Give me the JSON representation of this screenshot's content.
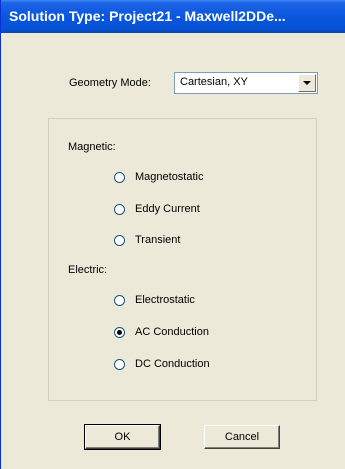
{
  "window": {
    "title": "Solution Type: Project21 - Maxwell2DDe..."
  },
  "geometry": {
    "label": "Geometry Mode:",
    "selected": "Cartesian, XY"
  },
  "magnetic": {
    "label": "Magnetic:",
    "options": [
      "Magnetostatic",
      "Eddy Current",
      "Transient"
    ]
  },
  "electric": {
    "label": "Electric:",
    "options": [
      "Electrostatic",
      "AC Conduction",
      "DC Conduction"
    ],
    "selected": "AC Conduction"
  },
  "buttons": {
    "ok": "OK",
    "cancel": "Cancel"
  }
}
